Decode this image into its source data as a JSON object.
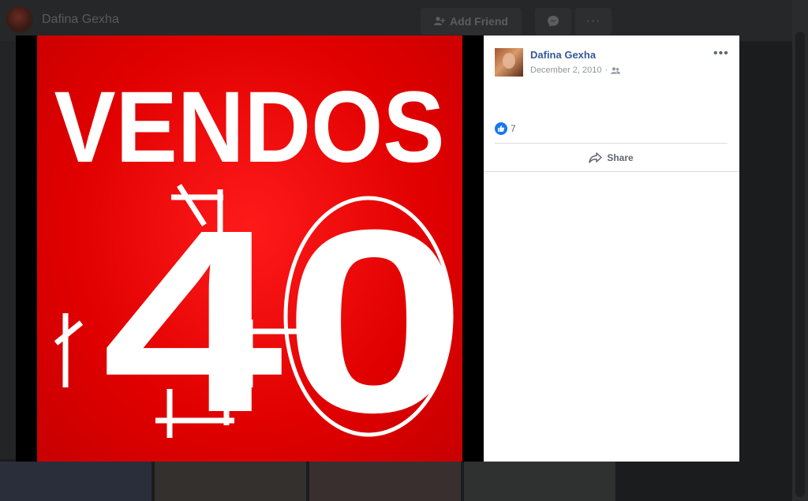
{
  "background": {
    "profile_name": "Dafina Gexha",
    "add_friend_label": "Add Friend",
    "more_label": "···"
  },
  "photo": {
    "headline": "VENDOS",
    "number": "40",
    "bg_color": "#e00000",
    "text_color": "#ffffff"
  },
  "post": {
    "author": "Dafina Gexha",
    "date": "December 2, 2010",
    "audience_icon": "friends-icon",
    "options_label": "•••",
    "like_count": "7",
    "share_label": "Share"
  },
  "colors": {
    "link": "#385898",
    "like": "#1877f2",
    "muted": "#90949c"
  }
}
